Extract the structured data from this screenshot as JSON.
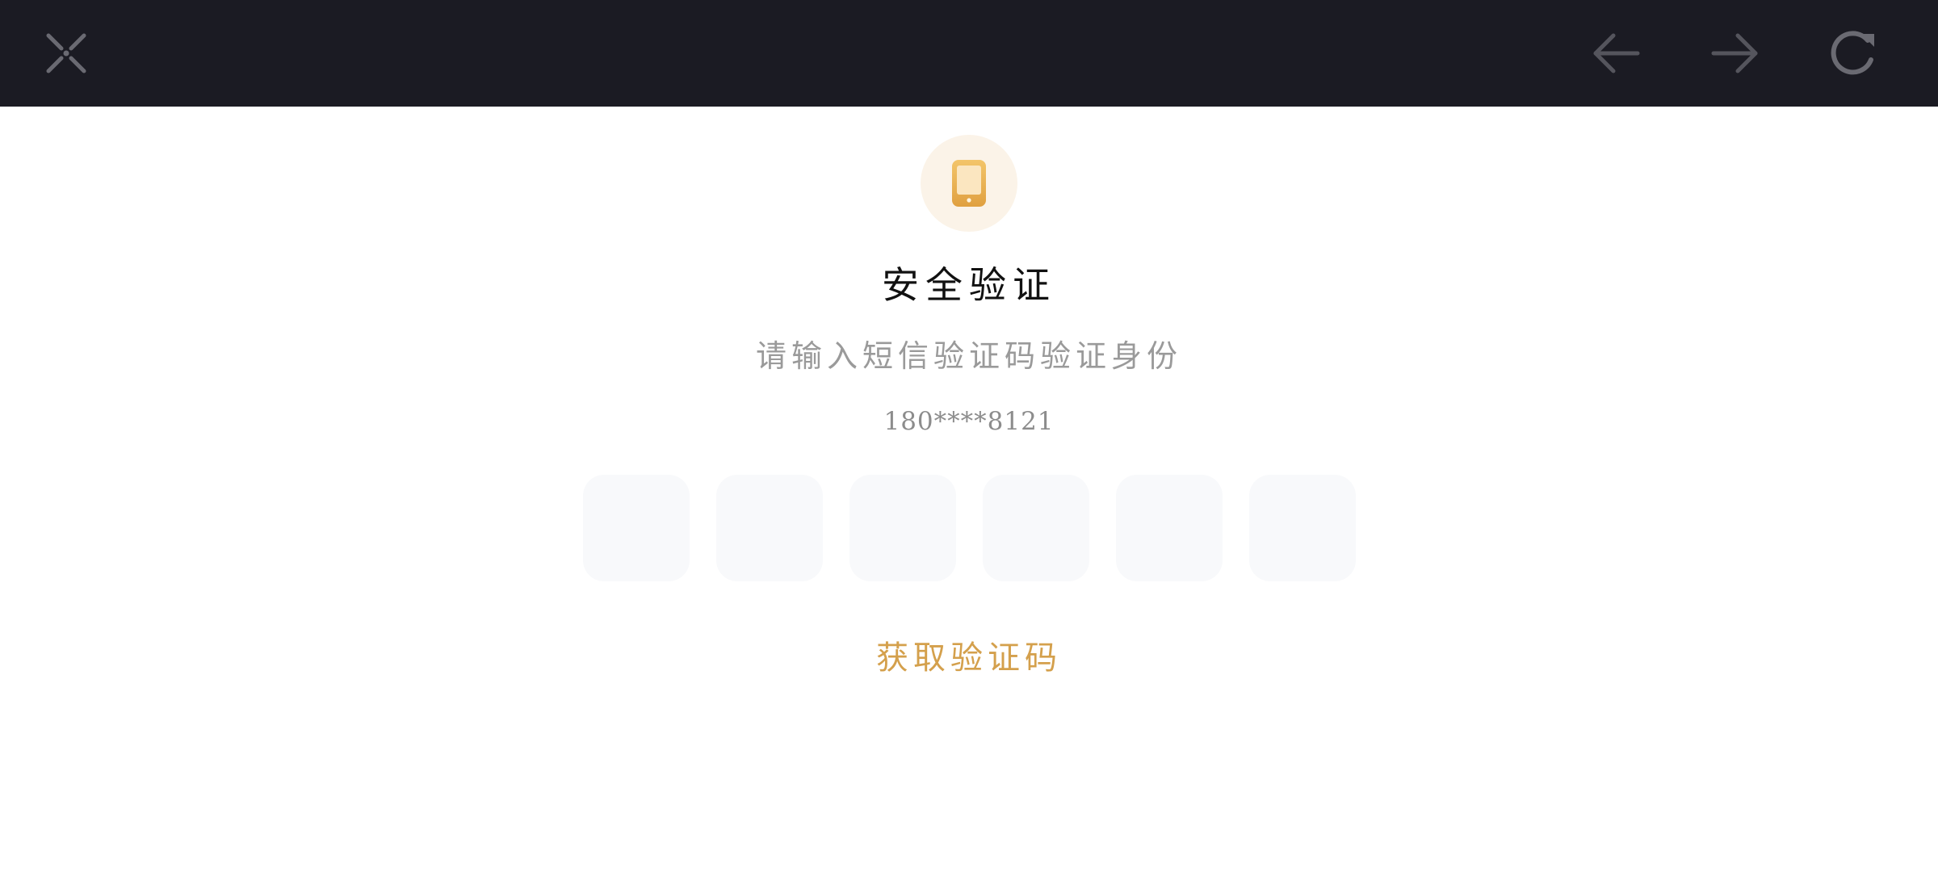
{
  "toolbar": {
    "close_icon": "close-x-icon",
    "back_icon": "arrow-left-icon",
    "forward_icon": "arrow-right-icon",
    "refresh_icon": "refresh-icon",
    "background_color": "#1b1b23",
    "icon_color": "#5e5e66"
  },
  "verification": {
    "badge_icon": "phone-icon",
    "badge_color": "#fbf3e8",
    "icon_color": "#e6a94a",
    "title": "安全验证",
    "subtitle": "请输入短信验证码验证身份",
    "phone_number": "180****8121",
    "code_inputs": [
      "",
      "",
      "",
      "",
      "",
      ""
    ],
    "get_code_label": "获取验证码",
    "accent_color": "#d4a04c"
  }
}
